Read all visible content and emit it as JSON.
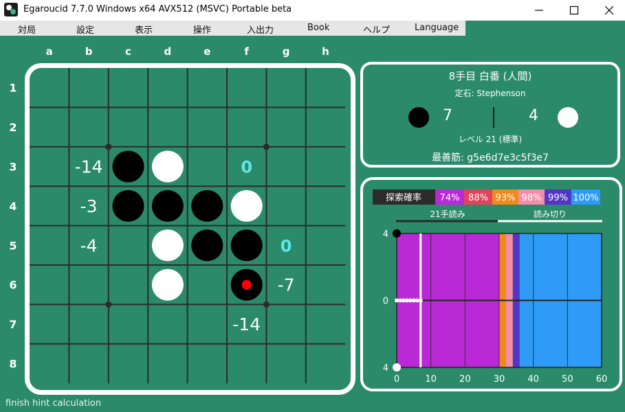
{
  "window": {
    "title": "Egaroucid 7.7.0 Windows x64 AVX512 (MSVC) Portable beta"
  },
  "menu": [
    "対局",
    "設定",
    "表示",
    "操作",
    "入出力",
    "Book",
    "ヘルプ",
    "Language"
  ],
  "board": {
    "col_labels": [
      "a",
      "b",
      "c",
      "d",
      "e",
      "f",
      "g",
      "h"
    ],
    "row_labels": [
      "1",
      "2",
      "3",
      "4",
      "5",
      "6",
      "7",
      "8"
    ],
    "stones": [
      {
        "cell": "c3",
        "color": "black"
      },
      {
        "cell": "d3",
        "color": "white"
      },
      {
        "cell": "c4",
        "color": "black"
      },
      {
        "cell": "d4",
        "color": "black"
      },
      {
        "cell": "e4",
        "color": "black"
      },
      {
        "cell": "f4",
        "color": "white"
      },
      {
        "cell": "d5",
        "color": "white"
      },
      {
        "cell": "e5",
        "color": "black"
      },
      {
        "cell": "f5",
        "color": "black"
      },
      {
        "cell": "d6",
        "color": "white"
      },
      {
        "cell": "f6",
        "color": "black",
        "last_move": true
      }
    ],
    "hints": [
      {
        "cell": "b3",
        "value": "-14",
        "best": false
      },
      {
        "cell": "f3",
        "value": "0",
        "best": true
      },
      {
        "cell": "b4",
        "value": "-3",
        "best": false
      },
      {
        "cell": "b5",
        "value": "-4",
        "best": false
      },
      {
        "cell": "g5",
        "value": "0",
        "best": true
      },
      {
        "cell": "g6",
        "value": "-7",
        "best": false
      },
      {
        "cell": "f7",
        "value": "-14",
        "best": false
      }
    ],
    "colors": {
      "line": "#2b2b2b",
      "surface": "#2a8a6a",
      "best_hint": "#5fe8e8",
      "last_move": "#ff0000"
    }
  },
  "info": {
    "move_status": "8手目 白番 (人間)",
    "opening": "定石: Stephenson",
    "black_count": "7",
    "white_count": "4",
    "level": "レベル 21 (標準)",
    "best_line": "最善筋: g5e6d7e3c5f3e7"
  },
  "graph": {
    "legend_label": "探索確率",
    "legend": [
      {
        "label": "74%",
        "color": "#b929d6"
      },
      {
        "label": "88%",
        "color": "#e0435a"
      },
      {
        "label": "93%",
        "color": "#ef8a1c"
      },
      {
        "label": "98%",
        "color": "#f28ea8"
      },
      {
        "label": "99%",
        "color": "#5236c6"
      },
      {
        "label": "100%",
        "color": "#2e9cf7"
      }
    ],
    "read_label_left": "21手読み",
    "read_label_right": "読み切り",
    "y_top_label": "4",
    "y_mid_label": "0",
    "y_bottom_label": "4",
    "x_ticks": [
      "0",
      "10",
      "20",
      "30",
      "40",
      "50",
      "60"
    ]
  },
  "status": "finish hint calculation",
  "chart_data": {
    "type": "area",
    "x": [
      0,
      1,
      2,
      3,
      4,
      5,
      6,
      7
    ],
    "values": [
      0,
      0,
      0,
      0,
      0,
      0,
      0,
      0
    ],
    "xlim": [
      0,
      60
    ],
    "ylim": [
      -4,
      4
    ],
    "current_move": 7,
    "bands": [
      {
        "from": 0,
        "to": 30,
        "color": "#b929d6"
      },
      {
        "from": 30,
        "to": 32,
        "color": "#ef8a1c"
      },
      {
        "from": 32,
        "to": 34,
        "color": "#f28ea8"
      },
      {
        "from": 34,
        "to": 36,
        "color": "#5236c6"
      },
      {
        "from": 36,
        "to": 60,
        "color": "#2e9cf7"
      }
    ]
  }
}
